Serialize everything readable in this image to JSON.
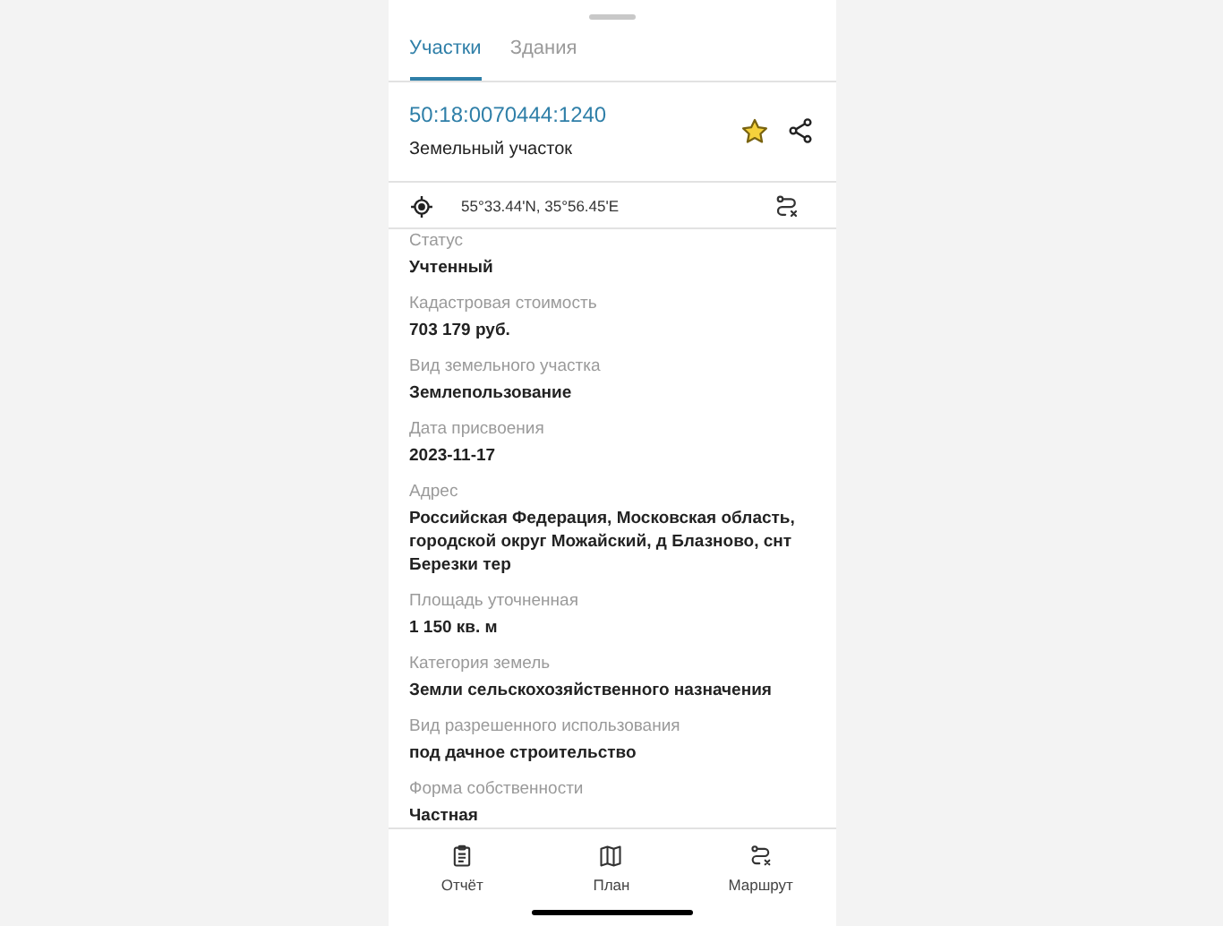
{
  "tabs": [
    {
      "label": "Участки",
      "selected": true
    },
    {
      "label": "Здания",
      "selected": false
    }
  ],
  "parcel": {
    "number": "50:18:0070444:1240",
    "type": "Земельный участок",
    "favorite": true
  },
  "coordinates": "55°33.44'N, 35°56.45'E",
  "fields": [
    {
      "label": "Статус",
      "value": "Учтенный"
    },
    {
      "label": "Кадастровая стоимость",
      "value": "703 179 руб."
    },
    {
      "label": "Вид земельного участка",
      "value": "Землепользование"
    },
    {
      "label": "Дата присвоения",
      "value": "2023-11-17"
    },
    {
      "label": "Адрес",
      "value": "Российская Федерация, Московская область, городской округ Можайский, д Блазново, снт Березки тер"
    },
    {
      "label": "Площадь уточненная",
      "value": "1 150 кв. м"
    },
    {
      "label": "Категория земель",
      "value": "Земли сельскохозяйственного назначения"
    },
    {
      "label": "Вид разрешенного использования",
      "value": "под дачное строительство"
    },
    {
      "label": "Форма собственности",
      "value": "Частная"
    }
  ],
  "bottom_nav": [
    {
      "kind": "report",
      "label": "Отчёт"
    },
    {
      "kind": "map",
      "label": "План"
    },
    {
      "kind": "route",
      "label": "Маршрут"
    }
  ]
}
